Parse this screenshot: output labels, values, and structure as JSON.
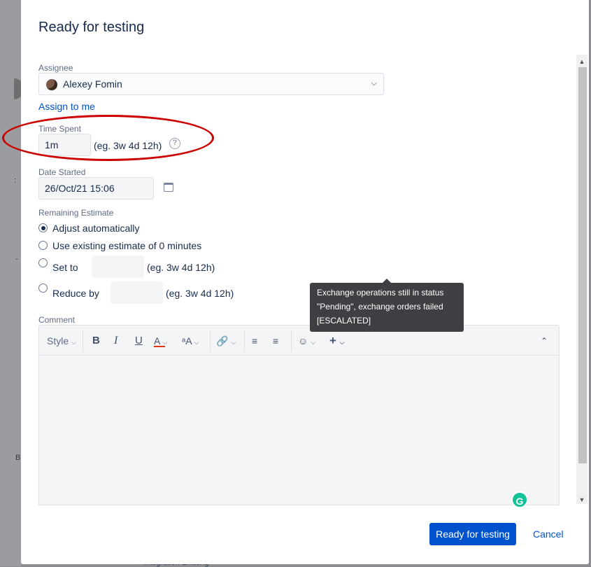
{
  "dialog": {
    "title": "Ready for testing"
  },
  "assignee": {
    "label": "Assignee",
    "value": "Alexey Fomin",
    "assign_to_me": "Assign to me"
  },
  "time_spent": {
    "label": "Time Spent",
    "value": "1m",
    "hint": "(eg. 3w 4d 12h)"
  },
  "date_started": {
    "label": "Date Started",
    "value": "26/Oct/21 15:06"
  },
  "remaining_estimate": {
    "label": "Remaining Estimate",
    "options": [
      {
        "label": "Adjust automatically",
        "checked": true
      },
      {
        "label": "Use existing estimate of 0 minutes",
        "checked": false
      },
      {
        "label": "Set to",
        "checked": false,
        "hint": "(eg. 3w 4d 12h)"
      },
      {
        "label": "Reduce by",
        "checked": false,
        "hint": "(eg. 3w 4d 12h)"
      }
    ]
  },
  "tooltip": {
    "lines": [
      "Exchange operations still in status",
      "\"Pending\", exchange orders failed",
      "[ESCALATED]"
    ]
  },
  "comment": {
    "label": "Comment",
    "toolbar": {
      "style_label": "Style",
      "bold": "B",
      "italic": "I",
      "underline": "U",
      "text_color": "A",
      "more_formatting": "ᵃA"
    }
  },
  "footer": {
    "primary_button": "Ready for testing",
    "cancel": "Cancel"
  },
  "background": {
    "bottom_text": "Integration Existing"
  },
  "colors": {
    "primary": "#0052cc",
    "annotation": "#cc0000",
    "tooltip_bg": "#3d3f42"
  }
}
